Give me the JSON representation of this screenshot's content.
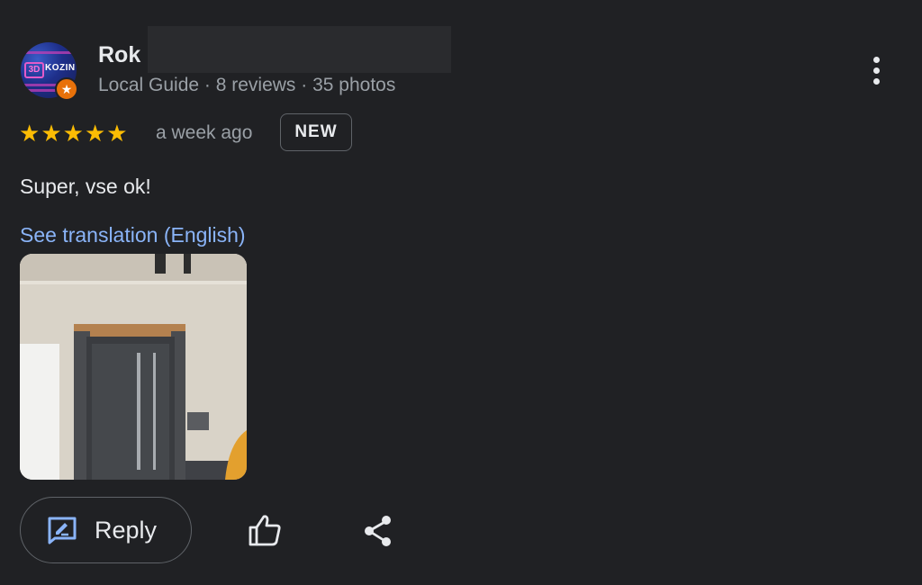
{
  "reviewer": {
    "name": "Rok",
    "meta": "Local Guide · 8 reviews · 35 photos",
    "avatar_text": "KOZIN",
    "avatar_mark": "3D"
  },
  "rating": {
    "stars": 5,
    "max": 5,
    "star_glyph": "★"
  },
  "time": "a week ago",
  "badge": "NEW",
  "review_text": "Super, vse ok!",
  "translation_link": "See translation (English)",
  "actions": {
    "reply_label": "Reply"
  },
  "colors": {
    "background": "#202124",
    "star": "#fbbc04",
    "link": "#8ab4f8",
    "secondary_text": "#9aa0a6",
    "local_guide_badge": "#e8710a"
  },
  "icons": [
    "more-vert-icon",
    "local-guide-badge-icon",
    "reply-icon",
    "thumbs-up-icon",
    "share-icon"
  ]
}
